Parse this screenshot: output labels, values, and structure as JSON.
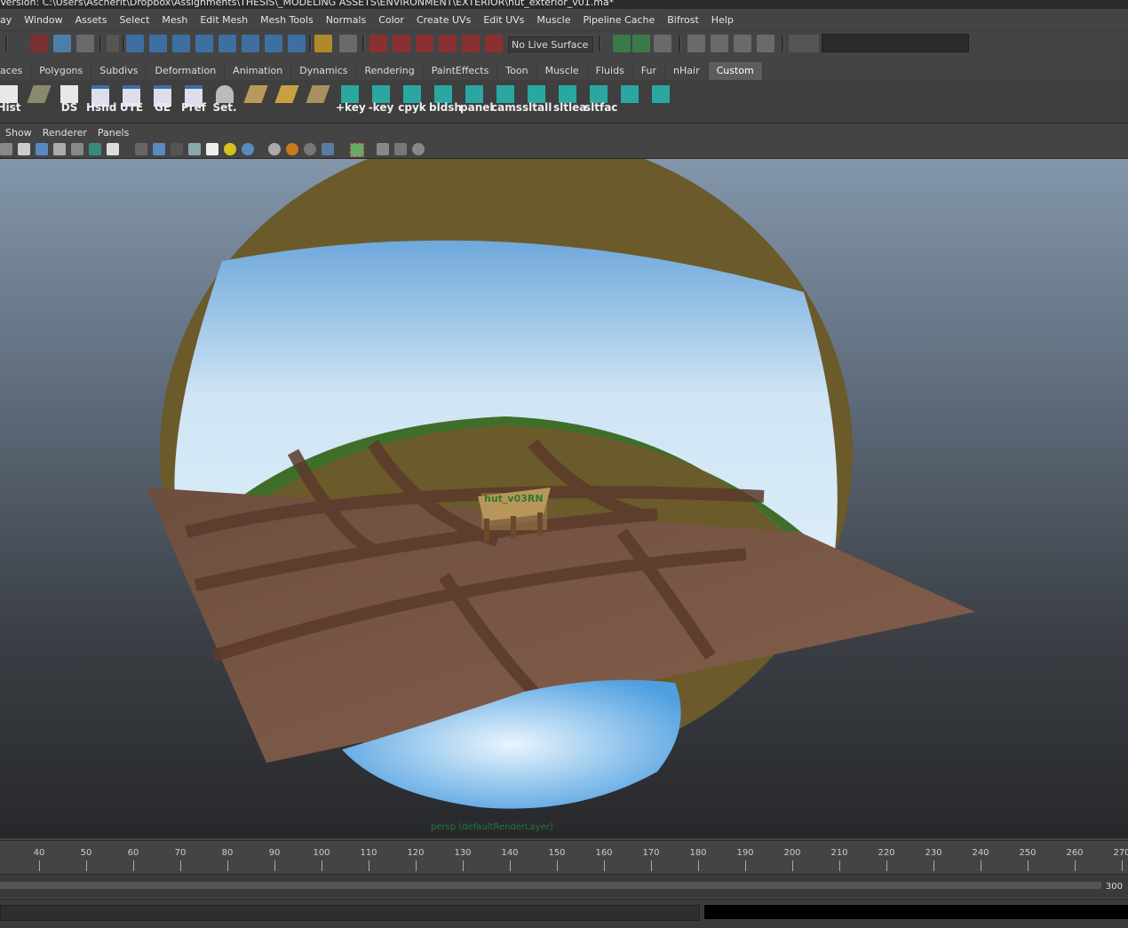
{
  "window": {
    "title": "Version: C:\\Users\\Ascherit\\Dropbox\\Assignments\\THESIS\\_MODELING ASSETS\\ENVIRONMENT\\EXTERIOR\\hut_exterior_v01.ma*"
  },
  "menubar": [
    "ay",
    "Window",
    "Assets",
    "Select",
    "Mesh",
    "Edit Mesh",
    "Mesh Tools",
    "Normals",
    "Color",
    "Create UVs",
    "Edit UVs",
    "Muscle",
    "Pipeline Cache",
    "Bifrost",
    "Help"
  ],
  "statusline": {
    "live_surface": "No Live Surface",
    "command_field": ""
  },
  "shelf_tabs": [
    "aces",
    "Polygons",
    "Subdivs",
    "Deformation",
    "Animation",
    "Dynamics",
    "Rendering",
    "PaintEffects",
    "Toon",
    "Muscle",
    "Fluids",
    "Fur",
    "nHair",
    "Custom"
  ],
  "active_shelf_tab": "Custom",
  "shelf_buttons": [
    "Hist",
    "",
    "DS",
    "Hshd",
    "UTE",
    "GE",
    "Pref",
    "Set.",
    "",
    "",
    "",
    "+key",
    "-key",
    "cpyk",
    "bldsh",
    "panel",
    "cams",
    "sltall",
    "sltlea",
    "sltfac",
    "",
    ""
  ],
  "panel_menu": [
    "Show",
    "Renderer",
    "Panels"
  ],
  "viewport": {
    "camera_label": "persp (defaultRenderLayer)",
    "object_label": "hut_v03RN"
  },
  "timeline": {
    "ticks": [
      "40",
      "50",
      "60",
      "70",
      "80",
      "90",
      "100",
      "110",
      "120",
      "130",
      "140",
      "150",
      "160",
      "170",
      "180",
      "190",
      "200",
      "210",
      "220",
      "230",
      "240",
      "250",
      "260",
      "270"
    ]
  },
  "range": {
    "end": "300"
  },
  "colors": {
    "ui_bg": "#444444",
    "active_tab": "#5d5d5d",
    "shelf_icon_teal": "#2aa7a0",
    "dome_brown": "#6b5a2a",
    "ground": "#7a5a48"
  }
}
